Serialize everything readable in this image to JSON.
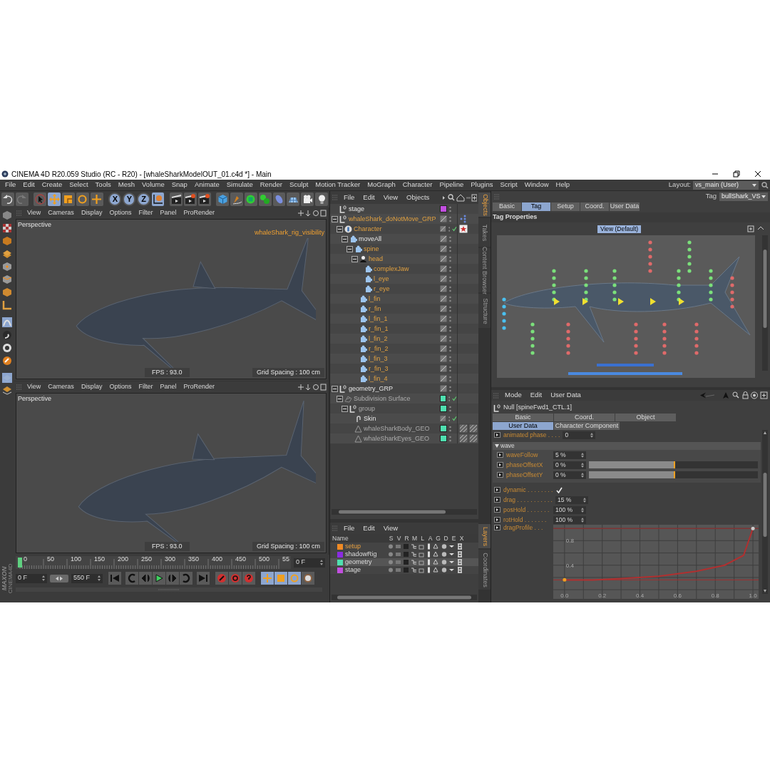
{
  "title_bar": {
    "title": "CINEMA 4D R20.059 Studio (RC - R20) - [whaleSharkModelOUT_01.c4d *] - Main"
  },
  "menu_bar": {
    "items": [
      "File",
      "Edit",
      "Create",
      "Select",
      "Tools",
      "Mesh",
      "Volume",
      "Snap",
      "Animate",
      "Simulate",
      "Render",
      "Sculpt",
      "Motion Tracker",
      "MoGraph",
      "Character",
      "Pipeline",
      "Plugins",
      "Script",
      "Window",
      "Help"
    ],
    "layout_label": "Layout:",
    "layout_value": "vs_main (User)"
  },
  "toolbar": {
    "axis_buttons": [
      "X",
      "Y",
      "Z"
    ]
  },
  "viewports": [
    {
      "menu": [
        "View",
        "Cameras",
        "Display",
        "Options",
        "Filter",
        "Panel",
        "ProRender"
      ],
      "camera": "Perspective",
      "overlay_label": "whaleShark_rig_visibility",
      "fps": "FPS : 93.0",
      "grid_spacing": "Grid Spacing : 100 cm"
    },
    {
      "menu": [
        "View",
        "Cameras",
        "Display",
        "Options",
        "Filter",
        "Panel",
        "ProRender"
      ],
      "camera": "Perspective",
      "fps": "FPS : 93.0",
      "grid_spacing": "Grid Spacing : 100 cm"
    }
  ],
  "logo": [
    "MAXON",
    "CINEMA4D"
  ],
  "timeline": {
    "ruler_labels": [
      "0",
      "50",
      "100",
      "150",
      "200",
      "250",
      "300",
      "350",
      "400",
      "450",
      "500",
      "55"
    ],
    "playhead": {
      "level": 0
    },
    "current_frame": "0 F",
    "start_frame": "0 F",
    "end_frame": "550 F"
  },
  "object_manager": {
    "menu": [
      "File",
      "Edit",
      "View",
      "Objects"
    ],
    "tree": [
      {
        "name": "stage",
        "kind": "null",
        "highlighted": false,
        "dimmed": false,
        "color": "#c24fe0",
        "checked": false
      },
      {
        "name": "whaleShark_doNotMove_GRP",
        "kind": "null",
        "highlighted": true,
        "dimmed": false,
        "checked": false,
        "tags": [
          {
            "kind": "pose"
          }
        ],
        "expanded": true,
        "children": [
          {
            "name": "Character",
            "kind": "character",
            "highlighted": true,
            "dimmed": false,
            "checked": true,
            "tags": [
              {
                "kind": "character"
              }
            ],
            "expanded": true,
            "children": [
              {
                "name": "moveAll",
                "kind": "joint",
                "highlighted": false,
                "dimmed": false,
                "checked": false,
                "expanded": true,
                "children": [
                  {
                    "name": "spine",
                    "kind": "joint",
                    "highlighted": true,
                    "dimmed": false,
                    "checked": false,
                    "expanded": true,
                    "children": [
                      {
                        "name": "head",
                        "kind": "head",
                        "highlighted": true,
                        "dimmed": false,
                        "checked": false,
                        "expanded": true,
                        "children": [
                          {
                            "name": "complexJaw",
                            "kind": "joint",
                            "highlighted": true,
                            "dimmed": false,
                            "checked": false
                          },
                          {
                            "name": "l_eye",
                            "kind": "joint",
                            "highlighted": true,
                            "dimmed": false,
                            "checked": false
                          },
                          {
                            "name": "r_eye",
                            "kind": "joint",
                            "highlighted": true,
                            "dimmed": false,
                            "checked": false
                          }
                        ]
                      },
                      {
                        "name": "l_fin",
                        "kind": "joint",
                        "highlighted": true,
                        "dimmed": false,
                        "checked": false
                      },
                      {
                        "name": "r_fin",
                        "kind": "joint",
                        "highlighted": true,
                        "dimmed": false,
                        "checked": false
                      },
                      {
                        "name": "l_fin_1",
                        "kind": "joint",
                        "highlighted": true,
                        "dimmed": false,
                        "checked": false
                      },
                      {
                        "name": "r_fin_1",
                        "kind": "joint",
                        "highlighted": true,
                        "dimmed": false,
                        "checked": false
                      },
                      {
                        "name": "l_fin_2",
                        "kind": "joint",
                        "highlighted": true,
                        "dimmed": false,
                        "checked": false
                      },
                      {
                        "name": "r_fin_2",
                        "kind": "joint",
                        "highlighted": true,
                        "dimmed": false,
                        "checked": false
                      },
                      {
                        "name": "l_fin_3",
                        "kind": "joint",
                        "highlighted": true,
                        "dimmed": false,
                        "checked": false
                      },
                      {
                        "name": "r_fin_3",
                        "kind": "joint",
                        "highlighted": true,
                        "dimmed": false,
                        "checked": false
                      },
                      {
                        "name": "l_fin_4",
                        "kind": "joint",
                        "highlighted": true,
                        "dimmed": false,
                        "checked": false
                      }
                    ]
                  }
                ]
              }
            ]
          }
        ]
      },
      {
        "name": "geometry_GRP",
        "kind": "null",
        "highlighted": false,
        "dimmed": false,
        "checked": false,
        "expanded": true,
        "children": [
          {
            "name": "Subdivision Surface",
            "kind": "subdivision",
            "highlighted": false,
            "dimmed": true,
            "color": "#4fe0b0",
            "checked": true,
            "expanded": true,
            "children": [
              {
                "name": "group",
                "kind": "null",
                "highlighted": false,
                "dimmed": true,
                "color": "#4fe0b0",
                "checked": false,
                "expanded": true,
                "children": [
                  {
                    "name": "Skin",
                    "kind": "skin",
                    "highlighted": false,
                    "dimmed": false,
                    "checked": true
                  },
                  {
                    "name": "whaleSharkBody_GEO",
                    "kind": "polygon",
                    "highlighted": false,
                    "dimmed": true,
                    "color": "#4fe0b0",
                    "checked": false,
                    "tags": [
                      {
                        "kind": "material"
                      },
                      {
                        "kind": "material"
                      }
                    ]
                  },
                  {
                    "name": "whaleSharkEyes_GEO",
                    "kind": "polygon",
                    "highlighted": false,
                    "dimmed": true,
                    "color": "#4fe0b0",
                    "checked": false,
                    "tags": [
                      {
                        "kind": "material"
                      },
                      {
                        "kind": "material"
                      }
                    ]
                  }
                ]
              }
            ]
          }
        ]
      }
    ]
  },
  "object_side_tabs": [
    {
      "label": "Objects",
      "selected": true
    },
    {
      "label": "Takes",
      "selected": false
    },
    {
      "label": "Content Browser",
      "selected": false
    },
    {
      "label": "Structure",
      "selected": false
    }
  ],
  "layer_manager": {
    "menu": [
      "File",
      "Edit",
      "View"
    ],
    "columns": [
      "Name",
      "S",
      "V",
      "R",
      "M",
      "L",
      "A",
      "G",
      "D",
      "E",
      "X"
    ],
    "layers": [
      {
        "name": "setup",
        "color": "#f08a24",
        "current": true,
        "selected": false
      },
      {
        "name": "shadowRig",
        "color": "#8a2be2",
        "current": false,
        "selected": false
      },
      {
        "name": "geometry",
        "color": "#4fe0b0",
        "current": false,
        "selected": true
      },
      {
        "name": "stage",
        "color": "#c24fe0",
        "current": false,
        "selected": false
      }
    ]
  },
  "layer_side_tabs": [
    {
      "label": "Layers",
      "selected": true
    },
    {
      "label": "Coordinates",
      "selected": false
    }
  ],
  "tag_attributes": {
    "type_label": "Tag",
    "object": "bullShark_VS",
    "tabs": [
      {
        "label": "Basic",
        "selected": false
      },
      {
        "label": "Tag",
        "selected": true
      },
      {
        "label": "Setup",
        "selected": false
      },
      {
        "label": "Coord.",
        "selected": false
      },
      {
        "label": "User Data",
        "selected": false
      }
    ],
    "section": "Tag Properties",
    "view_button": "View (Default)"
  },
  "object_attributes": {
    "menu": [
      "Mode",
      "Edit",
      "User Data"
    ],
    "object": "Null [spineFwd1_CTL.1]",
    "tabs": [
      {
        "label": "Basic",
        "selected": false
      },
      {
        "label": "Coord.",
        "selected": false
      },
      {
        "label": "Object",
        "selected": false
      },
      {
        "label": "User Data",
        "selected": true
      },
      {
        "label": "Character Component",
        "selected": false
      }
    ],
    "fields": [
      {
        "kind": "number",
        "label": "animated phase . . . .",
        "value": "0"
      },
      {
        "kind": "group",
        "label": "wave",
        "expanded": true,
        "children": [
          {
            "kind": "number",
            "label": "waveFollow",
            "value": "5 %"
          },
          {
            "kind": "slider",
            "label": "phaseOffsetX",
            "value": "0 %",
            "level": 0.51
          },
          {
            "kind": "slider",
            "label": "phaseOffsetY",
            "value": "0 %",
            "level": 0.51
          }
        ]
      },
      {
        "kind": "checkbox",
        "label": "dynamic . . . . . . . .",
        "checked": true
      },
      {
        "kind": "number",
        "label": "drag . . . . . . . . . . .",
        "value": "15 %"
      },
      {
        "kind": "number",
        "label": "posHold . . . . . . .",
        "value": "100 %"
      },
      {
        "kind": "number",
        "label": "rotHold . . . . . . .",
        "value": "100 %"
      },
      {
        "kind": "curve",
        "label": "dragProfile . . .",
        "chart_data": {
          "type": "line",
          "grid": true,
          "x": [
            0,
            0.15,
            0.3,
            0.5,
            0.7,
            0.85,
            0.95,
            1.0
          ],
          "series": [
            {
              "color": "#b03030",
              "values": [
                0.16,
                0.16,
                0.18,
                0.22,
                0.3,
                0.4,
                0.56,
                1.0
              ]
            }
          ],
          "ref_lines": [
            {
              "axis": "y",
              "value": 1.0,
              "color": "#a03030"
            },
            {
              "axis": "y",
              "value": 0.16,
              "color": "#a03030"
            }
          ],
          "xlim": [
            -0.06,
            1.03
          ],
          "ylim": [
            -0.15,
            1.06
          ],
          "xticks": [
            {
              "value": 0,
              "label": "0.0"
            },
            {
              "value": 0.2,
              "label": "0.2"
            },
            {
              "value": 0.4,
              "label": "0.4"
            },
            {
              "value": 0.6,
              "label": "0.6"
            },
            {
              "value": 0.8,
              "label": "0.8"
            },
            {
              "value": 1,
              "label": "1.0"
            }
          ],
          "yticks": [
            {
              "value": 0.4,
              "label": "0.4"
            },
            {
              "value": 0.8,
              "label": "0.8"
            }
          ]
        }
      }
    ]
  }
}
